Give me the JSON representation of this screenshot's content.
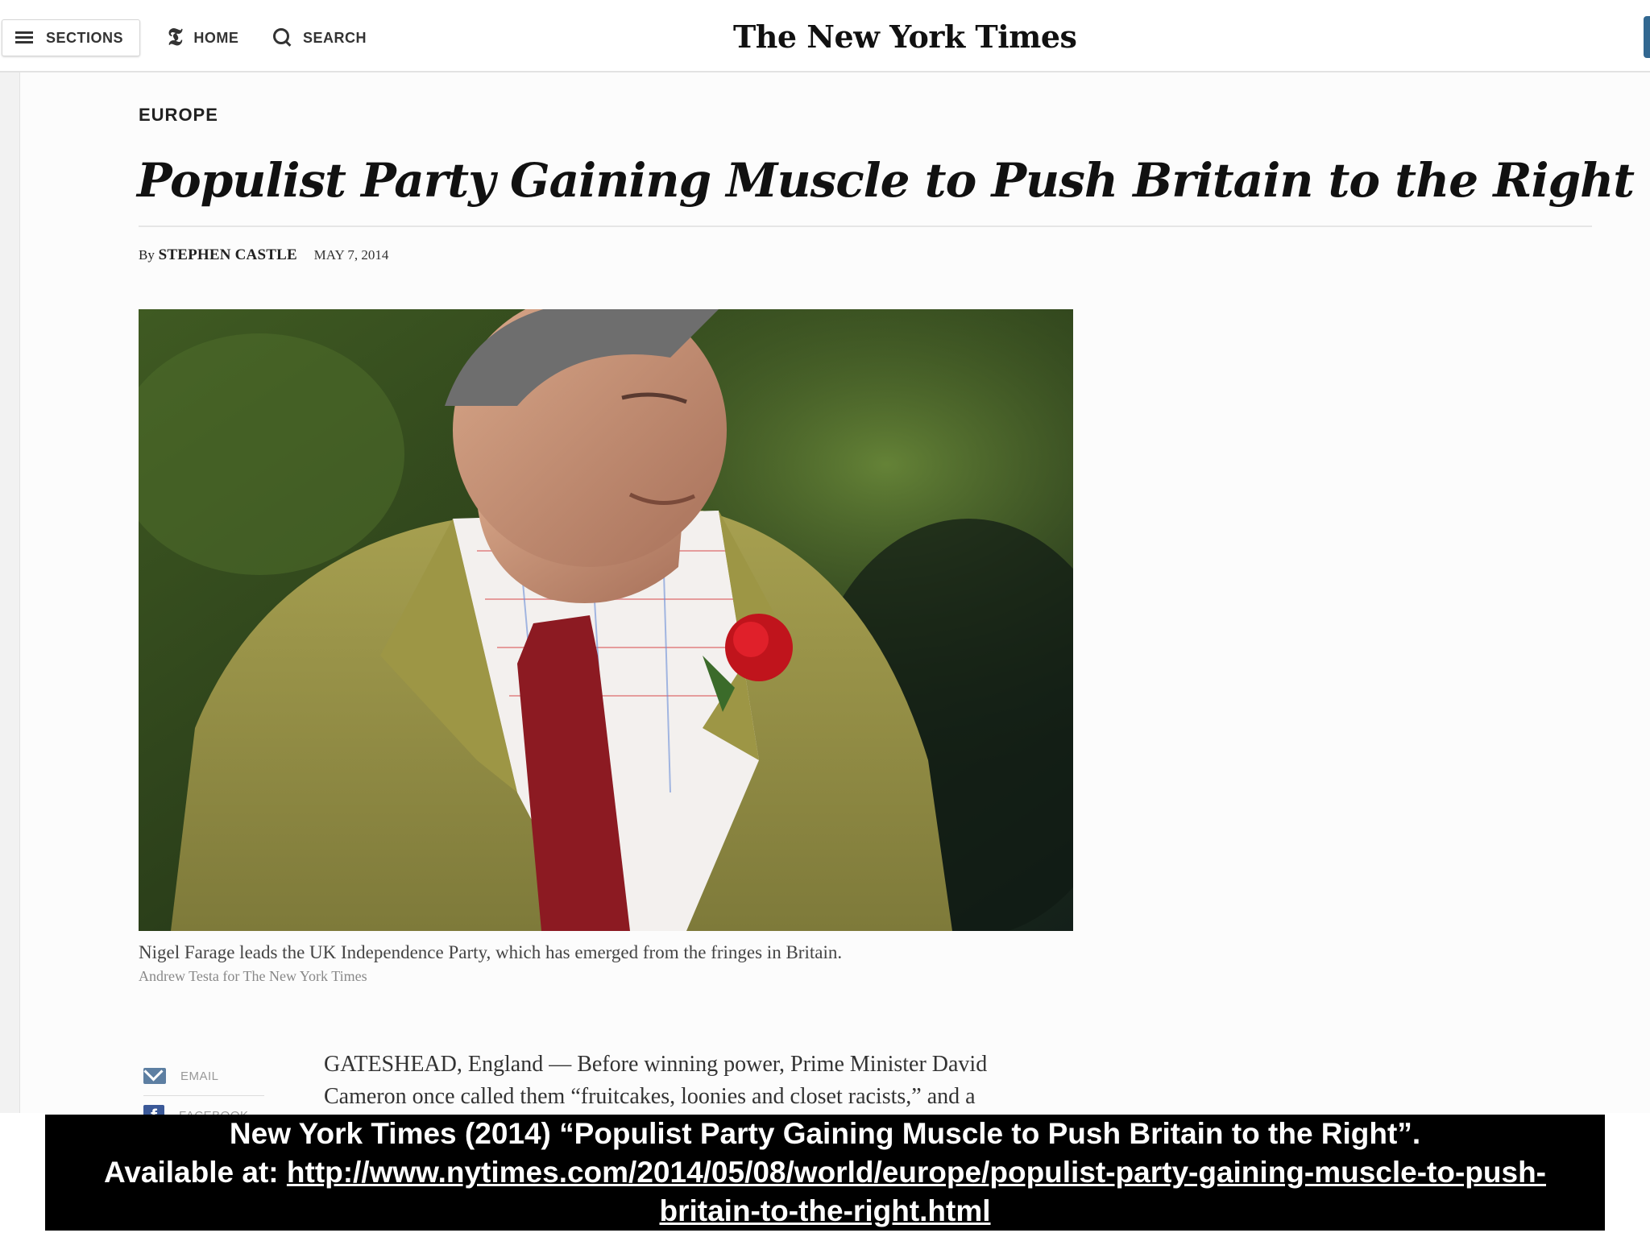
{
  "masthead": {
    "sections_label": "SECTIONS",
    "home_label": "HOME",
    "search_label": "SEARCH",
    "logo_text": "The New York Times",
    "accent_color": "#326891"
  },
  "article": {
    "kicker": "EUROPE",
    "headline": "Populist Party Gaining Muscle to Push Britain to the Right",
    "byline_prefix": "By",
    "author": "STEPHEN CASTLE",
    "date": "MAY 7, 2014",
    "photo_caption": "Nigel Farage leads the UK Independence Party, which has emerged from the fringes in Britain.",
    "photo_credit": "Andrew Testa for The New York Times",
    "body_line1": "GATESHEAD, England — Before winning power, Prime Minister David",
    "body_line2": "Cameron once called them “fruitcakes, loonies and closet racists,” and a"
  },
  "share": {
    "email_label": "EMAIL",
    "facebook_label": "FACEBOOK"
  },
  "citation": {
    "line1": "New York Times (2014) “Populist Party Gaining Muscle to Push Britain to the Right”.",
    "available_prefix": "Available at: ",
    "url_part1": "http://www.nytimes.com/2014/05/08/world/europe/populist-party-gaining-muscle-to-push-",
    "url_part2": "britain-to-the-right.html"
  }
}
